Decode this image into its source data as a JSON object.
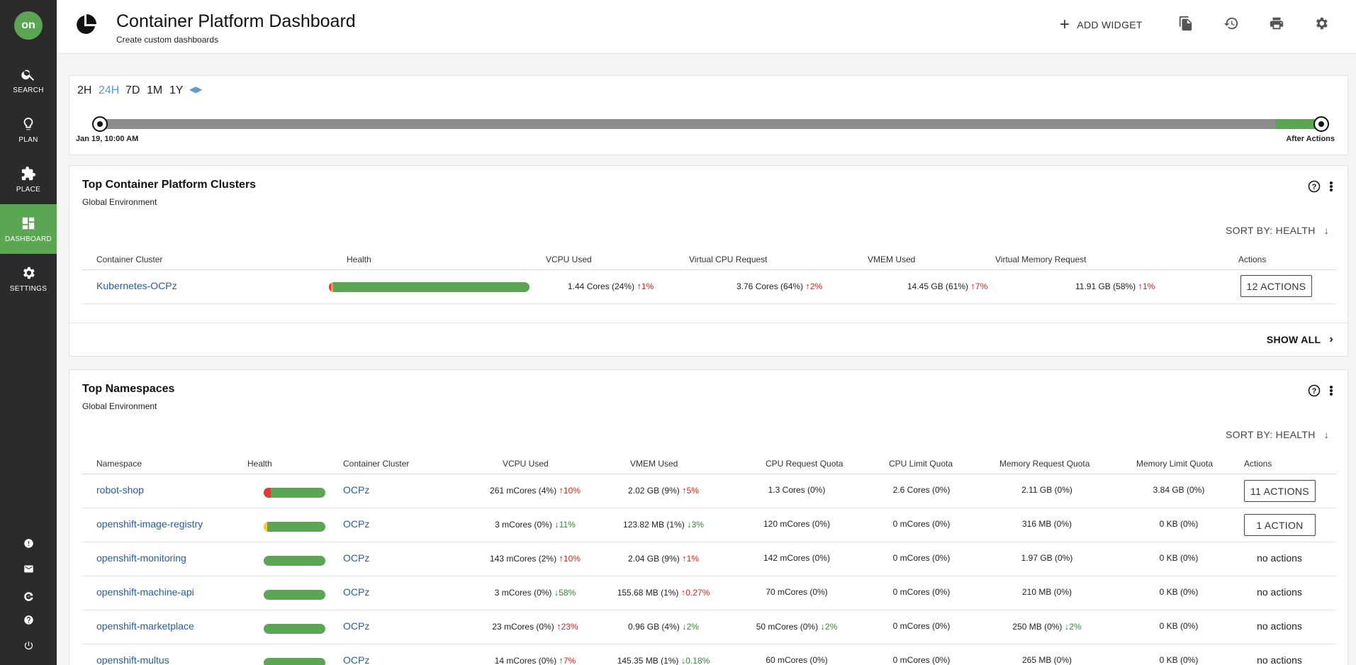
{
  "app": {
    "logo_text": "on",
    "title": "Container Platform Dashboard",
    "subtitle": "Create custom dashboards",
    "add_widget": "ADD WIDGET"
  },
  "sidebar": {
    "items": [
      {
        "label": "SEARCH",
        "icon": "search-icon"
      },
      {
        "label": "PLAN",
        "icon": "lightbulb-icon"
      },
      {
        "label": "PLACE",
        "icon": "puzzle-icon"
      },
      {
        "label": "DASHBOARD",
        "icon": "dashboard-icon",
        "active": true
      },
      {
        "label": "SETTINGS",
        "icon": "gear-icon"
      }
    ],
    "bottom_icons": [
      "alert-icon",
      "mail-icon",
      "google-icon",
      "help-icon",
      "power-icon"
    ]
  },
  "timeline": {
    "ranges": [
      "2H",
      "24H",
      "7D",
      "1M",
      "1Y"
    ],
    "active_range": "24H",
    "start_label": "Jan 19, 10:00 AM",
    "end_label": "After Actions"
  },
  "clusters": {
    "title": "Top Container Platform Clusters",
    "subtitle": "Global Environment",
    "sort_label": "SORT BY: HEALTH",
    "show_all": "SHOW ALL",
    "columns": [
      "Container Cluster",
      "Health",
      "VCPU Used",
      "Virtual CPU Request",
      "VMEM Used",
      "Virtual Memory Request",
      "Actions"
    ],
    "rows": [
      {
        "name": "Kubernetes-OCPz",
        "health": {
          "critical": 0.01,
          "minor": 0.01
        },
        "vcpu": "1.44 Cores (24%)",
        "vcpu_change": "1%",
        "vcpu_dir": "up",
        "vcpu_request": "3.76 Cores (64%)",
        "vcpu_request_change": "2%",
        "vcpu_request_dir": "up",
        "vmem": "14.45 GB (61%)",
        "vmem_change": "7%",
        "vmem_dir": "up",
        "vmem_request": "11.91 GB (58%)",
        "vmem_request_change": "1%",
        "vmem_request_dir": "up",
        "actions": "12 ACTIONS"
      }
    ]
  },
  "namespaces": {
    "title": "Top Namespaces",
    "subtitle": "Global Environment",
    "sort_label": "SORT BY: HEALTH",
    "columns": [
      "Namespace",
      "Health",
      "Container Cluster",
      "VCPU Used",
      "VMEM Used",
      "CPU Request Quota",
      "CPU Limit Quota",
      "Memory Request Quota",
      "Memory Limit Quota",
      "Actions"
    ],
    "rows": [
      {
        "name": "robot-shop",
        "health": {
          "color": "#e53935",
          "fraction": 0.12
        },
        "cluster": "OCPz",
        "vcpu": "261 mCores (4%)",
        "vcpu_change": "10%",
        "vcpu_dir": "up",
        "vmem": "2.02 GB (9%)",
        "vmem_change": "5%",
        "vmem_dir": "up",
        "cpu_req": "1.3 Cores (0%)",
        "cpu_req_change": "",
        "cpu_req_dir": "",
        "cpu_limit": "2.6 Cores (0%)",
        "mem_req": "2.11 GB (0%)",
        "mem_req_change": "",
        "mem_req_dir": "",
        "mem_limit": "3.84 GB (0%)",
        "actions": "11 ACTIONS",
        "has_button": true
      },
      {
        "name": "openshift-image-registry",
        "health": {
          "color": "#f2d033",
          "fraction": 0.06
        },
        "cluster": "OCPz",
        "vcpu": "3 mCores (0%)",
        "vcpu_change": "11%",
        "vcpu_dir": "down",
        "vmem": "123.82 MB (1%)",
        "vmem_change": "3%",
        "vmem_dir": "down",
        "cpu_req": "120 mCores (0%)",
        "cpu_req_change": "",
        "cpu_req_dir": "",
        "cpu_limit": "0 mCores (0%)",
        "mem_req": "316 MB (0%)",
        "mem_req_change": "",
        "mem_req_dir": "",
        "mem_limit": "0 KB (0%)",
        "actions": "1 ACTION",
        "has_button": true
      },
      {
        "name": "openshift-monitoring",
        "health": {
          "color": "",
          "fraction": 0
        },
        "cluster": "OCPz",
        "vcpu": "143 mCores (2%)",
        "vcpu_change": "10%",
        "vcpu_dir": "up",
        "vmem": "2.04 GB (9%)",
        "vmem_change": "1%",
        "vmem_dir": "up",
        "cpu_req": "142 mCores (0%)",
        "cpu_req_change": "",
        "cpu_req_dir": "",
        "cpu_limit": "0 mCores (0%)",
        "mem_req": "1.97 GB (0%)",
        "mem_req_change": "",
        "mem_req_dir": "",
        "mem_limit": "0 KB (0%)",
        "actions": "no actions",
        "has_button": false
      },
      {
        "name": "openshift-machine-api",
        "health": {
          "color": "",
          "fraction": 0
        },
        "cluster": "OCPz",
        "vcpu": "3 mCores (0%)",
        "vcpu_change": "58%",
        "vcpu_dir": "down",
        "vmem": "155.68 MB (1%)",
        "vmem_change": "0.27%",
        "vmem_dir": "up",
        "cpu_req": "70 mCores (0%)",
        "cpu_req_change": "",
        "cpu_req_dir": "",
        "cpu_limit": "0 mCores (0%)",
        "mem_req": "210 MB (0%)",
        "mem_req_change": "",
        "mem_req_dir": "",
        "mem_limit": "0 KB (0%)",
        "actions": "no actions",
        "has_button": false
      },
      {
        "name": "openshift-marketplace",
        "health": {
          "color": "",
          "fraction": 0
        },
        "cluster": "OCPz",
        "vcpu": "23 mCores (0%)",
        "vcpu_change": "23%",
        "vcpu_dir": "up",
        "vmem": "0.96 GB (4%)",
        "vmem_change": "2%",
        "vmem_dir": "down",
        "cpu_req": "50 mCores (0%)",
        "cpu_req_change": "2%",
        "cpu_req_dir": "down",
        "cpu_limit": "0 mCores (0%)",
        "mem_req": "250 MB (0%)",
        "mem_req_change": "2%",
        "mem_req_dir": "down",
        "mem_limit": "0 KB (0%)",
        "actions": "no actions",
        "has_button": false
      },
      {
        "name": "openshift-multus",
        "health": {
          "color": "",
          "fraction": 0
        },
        "cluster": "OCPz",
        "vcpu": "14 mCores (0%)",
        "vcpu_change": "7%",
        "vcpu_dir": "up",
        "vmem": "145.35 MB (1%)",
        "vmem_change": "0.18%",
        "vmem_dir": "down",
        "cpu_req": "60 mCores (0%)",
        "cpu_req_change": "",
        "cpu_req_dir": "",
        "cpu_limit": "0 mCores (0%)",
        "mem_req": "265 MB (0%)",
        "mem_req_change": "",
        "mem_req_dir": "",
        "mem_limit": "0 KB (0%)",
        "actions": "no actions",
        "has_button": false
      }
    ]
  },
  "colors": {
    "accent": "#5aa653",
    "link": "#1f5fa8",
    "up": "#e02020",
    "down": "#2e8b2e",
    "active_range": "#5b9bd5"
  }
}
